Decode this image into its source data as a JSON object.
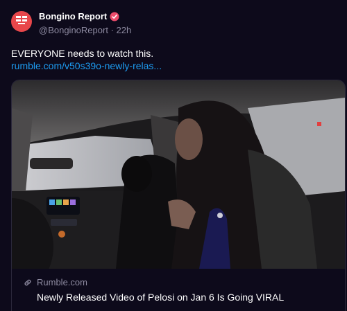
{
  "post": {
    "author_name": "Bongino Report",
    "handle": "@BonginoReport",
    "separator": "·",
    "time": "22h",
    "text": "EVERYONE needs to watch this.",
    "link_text": "rumble.com/v50s39o-newly-relas..."
  },
  "link_card": {
    "source": "Rumble.com",
    "title": "Newly Released Video of Pelosi on Jan 6 Is Going VIRAL"
  },
  "colors": {
    "background": "#0d0a1b",
    "brand_avatar": "#e8474b",
    "verified_badge": "#ec4c6b",
    "link": "#1d9bf0",
    "muted_text": "#8d8aa0"
  },
  "icons": [
    "bongino-logo-icon",
    "verified-badge-icon",
    "link-chain-icon"
  ]
}
